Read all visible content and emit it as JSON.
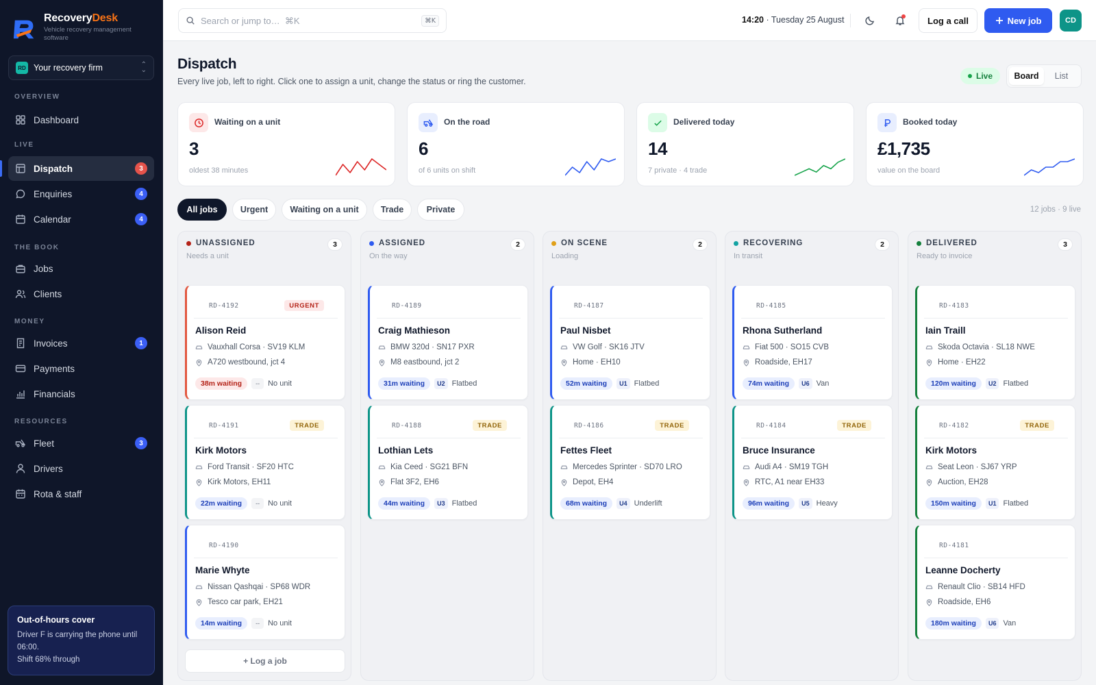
{
  "brand": {
    "name_main": "Recovery",
    "name_accent": "Desk",
    "tagline": "Vehicle recovery management software"
  },
  "firm": {
    "badge": "RD",
    "label": "Your recovery firm"
  },
  "sidebar": {
    "sections": [
      "OVERVIEW",
      "LIVE",
      "THE BOOK",
      "MONEY",
      "RESOURCES"
    ],
    "items": [
      {
        "label": "Dashboard",
        "icon": "grid-icon",
        "count": null
      },
      {
        "label": "Dispatch",
        "icon": "board-icon",
        "count": "3",
        "active": true
      },
      {
        "label": "Enquiries",
        "icon": "chat-icon",
        "count": "4"
      },
      {
        "label": "Calendar",
        "icon": "calendar-icon",
        "count": "4"
      },
      {
        "label": "Jobs",
        "icon": "briefcase-icon",
        "count": null
      },
      {
        "label": "Clients",
        "icon": "users-icon",
        "count": null
      },
      {
        "label": "Invoices",
        "icon": "invoice-icon",
        "count": "1"
      },
      {
        "label": "Payments",
        "icon": "card-icon",
        "count": null
      },
      {
        "label": "Financials",
        "icon": "chart-icon",
        "count": null
      },
      {
        "label": "Fleet",
        "icon": "truck-icon",
        "count": "3"
      },
      {
        "label": "Drivers",
        "icon": "user-icon",
        "count": null
      },
      {
        "label": "Rota & staff",
        "icon": "calendar-grid-icon",
        "count": null
      }
    ]
  },
  "ooh": {
    "title": "Out-of-hours cover",
    "text1": "Driver F is carrying the phone until 06:00.",
    "text2": "Shift 68% through",
    "shift_progress": 0.68
  },
  "topbar": {
    "search_placeholder": "Search or jump to…  ⌘K",
    "search_kbd": "⌘K",
    "time": "14:20",
    "date": " · Tuesday 25 August",
    "log_call": "Log a call",
    "new_job": "New job",
    "avatar": "CD"
  },
  "header": {
    "title": "Dispatch",
    "subtitle": "Every live job, left to right. Click one to assign a unit, change the status or ring the customer.",
    "live": "Live",
    "view_board": "Board",
    "view_list": "List"
  },
  "stats": [
    {
      "label": "Waiting on a unit",
      "value": "3",
      "sub": "oldest 38 minutes",
      "icon": "clock-icon",
      "color": "#dc2626",
      "bg": "#fde8e8",
      "spark": [
        2,
        6,
        3,
        7,
        4,
        8,
        6,
        4
      ]
    },
    {
      "label": "On the road",
      "value": "6",
      "sub": "of 6 units on shift",
      "icon": "truck-icon",
      "color": "#2f5bf0",
      "bg": "#e8eefe",
      "spark": [
        2,
        5,
        3,
        7,
        4,
        8,
        7,
        8
      ]
    },
    {
      "label": "Delivered today",
      "value": "14",
      "sub": "7 private · 4 trade",
      "icon": "check-icon",
      "color": "#16a34a",
      "bg": "#dcfce7",
      "spark": [
        1,
        2,
        3,
        2,
        4,
        3,
        5,
        6
      ]
    },
    {
      "label": "Booked today",
      "value": "£1,735",
      "sub": "value on the board",
      "icon": "pound-icon",
      "color": "#2f5bf0",
      "bg": "#e8eefe",
      "spark": [
        2,
        4,
        3,
        5,
        5,
        7,
        7,
        8
      ]
    }
  ],
  "filters": [
    "All jobs",
    "Urgent",
    "Waiting on a unit",
    "Trade",
    "Private"
  ],
  "jobs_summary": "12 jobs · 9 live",
  "columns": [
    {
      "title": "UNASSIGNED",
      "sub": "Needs a unit",
      "count": "3",
      "dot": "#b42318",
      "cards": [
        {
          "ref": "RD-4192",
          "tag": "URGENT",
          "tagType": "urgent",
          "name": "Alison Reid",
          "vehicle": "Vauxhall Corsa · SV19 KLM",
          "location": "A720 westbound, jct 4",
          "wait": "38m waiting",
          "waitRed": true,
          "unit": "--",
          "unitType": "No unit",
          "border": "#e2573f"
        },
        {
          "ref": "RD-4191",
          "tag": "TRADE",
          "tagType": "trade",
          "name": "Kirk Motors",
          "vehicle": "Ford Transit · SF20 HTC",
          "location": "Kirk Motors, EH11",
          "wait": "22m waiting",
          "unit": "--",
          "unitType": "No unit",
          "border": "#0d9488"
        },
        {
          "ref": "RD-4190",
          "tag": "",
          "name": "Marie Whyte",
          "vehicle": "Nissan Qashqai · SP68 WDR",
          "location": "Tesco car park, EH21",
          "wait": "14m waiting",
          "unit": "--",
          "unitType": "No unit",
          "border": "#2f5bf0"
        }
      ],
      "log": "+ Log a job"
    },
    {
      "title": "ASSIGNED",
      "sub": "On the way",
      "count": "2",
      "dot": "#2f5bf0",
      "cards": [
        {
          "ref": "RD-4189",
          "tag": "",
          "name": "Craig Mathieson",
          "vehicle": "BMW 320d · SN17 PXR",
          "location": "M8 eastbound, jct 2",
          "wait": "31m waiting",
          "unit": "U2",
          "unitType": "Flatbed",
          "border": "#2f5bf0"
        },
        {
          "ref": "RD-4188",
          "tag": "TRADE",
          "tagType": "trade",
          "name": "Lothian Lets",
          "vehicle": "Kia Ceed · SG21 BFN",
          "location": "Flat 3F2, EH6",
          "wait": "44m waiting",
          "unit": "U3",
          "unitType": "Flatbed",
          "border": "#0d9488"
        }
      ]
    },
    {
      "title": "ON SCENE",
      "sub": "Loading",
      "count": "2",
      "dot": "#e0a019",
      "cards": [
        {
          "ref": "RD-4187",
          "tag": "",
          "name": "Paul Nisbet",
          "vehicle": "VW Golf · SK16 JTV",
          "location": "Home · EH10",
          "wait": "52m waiting",
          "unit": "U1",
          "unitType": "Flatbed",
          "border": "#2f5bf0"
        },
        {
          "ref": "RD-4186",
          "tag": "TRADE",
          "tagType": "trade",
          "name": "Fettes Fleet",
          "vehicle": "Mercedes Sprinter · SD70 LRO",
          "location": "Depot, EH4",
          "wait": "68m waiting",
          "unit": "U4",
          "unitType": "Underlift",
          "border": "#0d9488"
        }
      ]
    },
    {
      "title": "RECOVERING",
      "sub": "In transit",
      "count": "2",
      "dot": "#14a3a3",
      "cards": [
        {
          "ref": "RD-4185",
          "tag": "",
          "name": "Rhona Sutherland",
          "vehicle": "Fiat 500 · SO15 CVB",
          "location": "Roadside, EH17",
          "wait": "74m waiting",
          "unit": "U6",
          "unitType": "Van",
          "border": "#2f5bf0"
        },
        {
          "ref": "RD-4184",
          "tag": "TRADE",
          "tagType": "trade",
          "name": "Bruce Insurance",
          "vehicle": "Audi A4 · SM19 TGH",
          "location": "RTC, A1 near EH33",
          "wait": "96m waiting",
          "unit": "U5",
          "unitType": "Heavy",
          "border": "#0d9488"
        }
      ]
    },
    {
      "title": "DELIVERED",
      "sub": "Ready to invoice",
      "count": "3",
      "dot": "#15803d",
      "cards": [
        {
          "ref": "RD-4183",
          "tag": "",
          "name": "Iain Traill",
          "vehicle": "Skoda Octavia · SL18 NWE",
          "location": "Home · EH22",
          "wait": "120m waiting",
          "unit": "U2",
          "unitType": "Flatbed",
          "border": "#15803d"
        },
        {
          "ref": "RD-4182",
          "tag": "TRADE",
          "tagType": "trade",
          "name": "Kirk Motors",
          "vehicle": "Seat Leon · SJ67 YRP",
          "location": "Auction, EH28",
          "wait": "150m waiting",
          "unit": "U1",
          "unitType": "Flatbed",
          "border": "#15803d"
        },
        {
          "ref": "RD-4181",
          "tag": "",
          "name": "Leanne Docherty",
          "vehicle": "Renault Clio · SB14 HFD",
          "location": "Roadside, EH6",
          "wait": "180m waiting",
          "unit": "U6",
          "unitType": "Van",
          "border": "#15803d"
        }
      ]
    }
  ]
}
